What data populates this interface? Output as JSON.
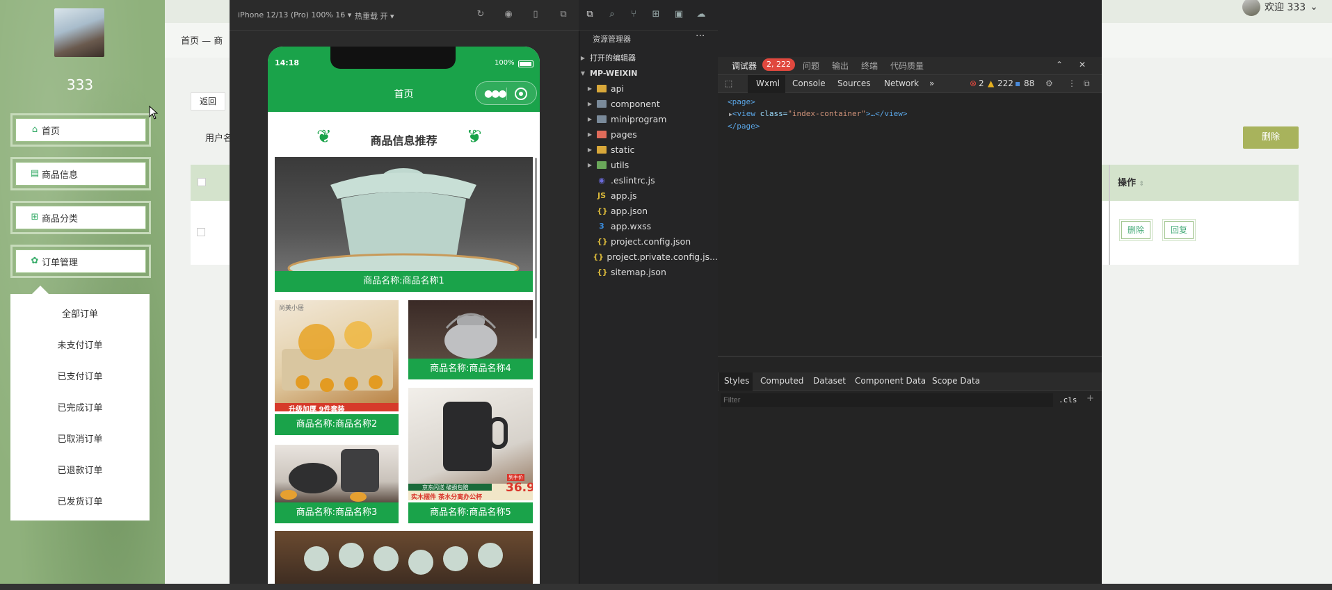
{
  "admin": {
    "username": "333",
    "welcome": "欢迎 333",
    "breadcrumb": "首页 — 商",
    "menu": [
      {
        "label": "首页",
        "icon": "home-icon"
      },
      {
        "label": "商品信息",
        "icon": "product-icon"
      },
      {
        "label": "商品分类",
        "icon": "category-icon"
      },
      {
        "label": "订单管理",
        "icon": "order-icon"
      }
    ],
    "submenu": [
      "全部订单",
      "未支付订单",
      "已支付订单",
      "已完成订单",
      "已取消订单",
      "已退款订单",
      "已发货订单"
    ],
    "back_label": "返回",
    "user_label": "用户名",
    "delete_label": "删除",
    "table": {
      "op_header": "操作",
      "row_buttons": [
        "删除",
        "回复"
      ]
    }
  },
  "simulator": {
    "device": "iPhone 12/13 (Pro) 100% 16 ▾",
    "hot_reload": "热重载 开 ▾",
    "status_time": "14:18",
    "battery": "100%",
    "nav_title": "首页",
    "section_title": "商品信息推荐",
    "products": [
      "商品名称:商品名称1",
      "商品名称:商品名称2",
      "商品名称:商品名称3",
      "商品名称:商品名称4",
      "商品名称:商品名称5"
    ],
    "image_texts": {
      "p2_banner": "升级加厚 9件套装",
      "p5_banner": "实木摆件 茶水分离办公杯",
      "p5_tag": "京东闪送 破损包赔",
      "p5_price": "36.9",
      "p5_price_tag": "到手价",
      "p2_brand": "尚美小居"
    }
  },
  "explorer": {
    "title": "资源管理器",
    "open_editors": "打开的编辑器",
    "root": "MP-WEIXIN",
    "items": [
      {
        "name": "api",
        "type": "folder",
        "color": "#d9a83a"
      },
      {
        "name": "component",
        "type": "folder",
        "color": "#7a8a9a"
      },
      {
        "name": "miniprogram",
        "type": "folder",
        "color": "#7a8a9a"
      },
      {
        "name": "pages",
        "type": "folder",
        "color": "#e06b5a"
      },
      {
        "name": "static",
        "type": "folder",
        "color": "#d9a83a"
      },
      {
        "name": "utils",
        "type": "folder",
        "color": "#6aa75a"
      },
      {
        "name": ".eslintrc.js",
        "type": "file",
        "glyph": "◉",
        "color": "#6a6ad9"
      },
      {
        "name": "app.js",
        "type": "file",
        "glyph": "JS",
        "color": "#d9b83a"
      },
      {
        "name": "app.json",
        "type": "file",
        "glyph": "{}",
        "color": "#d9b83a"
      },
      {
        "name": "app.wxss",
        "type": "file",
        "glyph": "3",
        "color": "#3a8ad9"
      },
      {
        "name": "project.config.json",
        "type": "file",
        "glyph": "{}",
        "color": "#d9b83a"
      },
      {
        "name": "project.private.config.js...",
        "type": "file",
        "glyph": "{}",
        "color": "#d9b83a"
      },
      {
        "name": "sitemap.json",
        "type": "file",
        "glyph": "{}",
        "color": "#d9b83a"
      }
    ]
  },
  "devtools": {
    "tabs": [
      "调试器",
      "问题",
      "输出",
      "终端",
      "代码质量"
    ],
    "error_badge": "2, 222",
    "panel_tabs": [
      "Wxml",
      "Console",
      "Sources",
      "Network",
      "»"
    ],
    "counts": {
      "errors": "2",
      "warnings": "222",
      "info": "88"
    },
    "wxml": {
      "line1": "<page>",
      "line2_tag_open": "<view",
      "line2_attr": " class=",
      "line2_val": "\"index-container\"",
      "line2_rest": ">…</view>",
      "line3": "</page>"
    },
    "style_tabs": [
      "Styles",
      "Computed",
      "Dataset",
      "Component Data",
      "Scope Data"
    ],
    "filter_placeholder": "Filter",
    "cls": ".cls",
    "plus": "+"
  }
}
